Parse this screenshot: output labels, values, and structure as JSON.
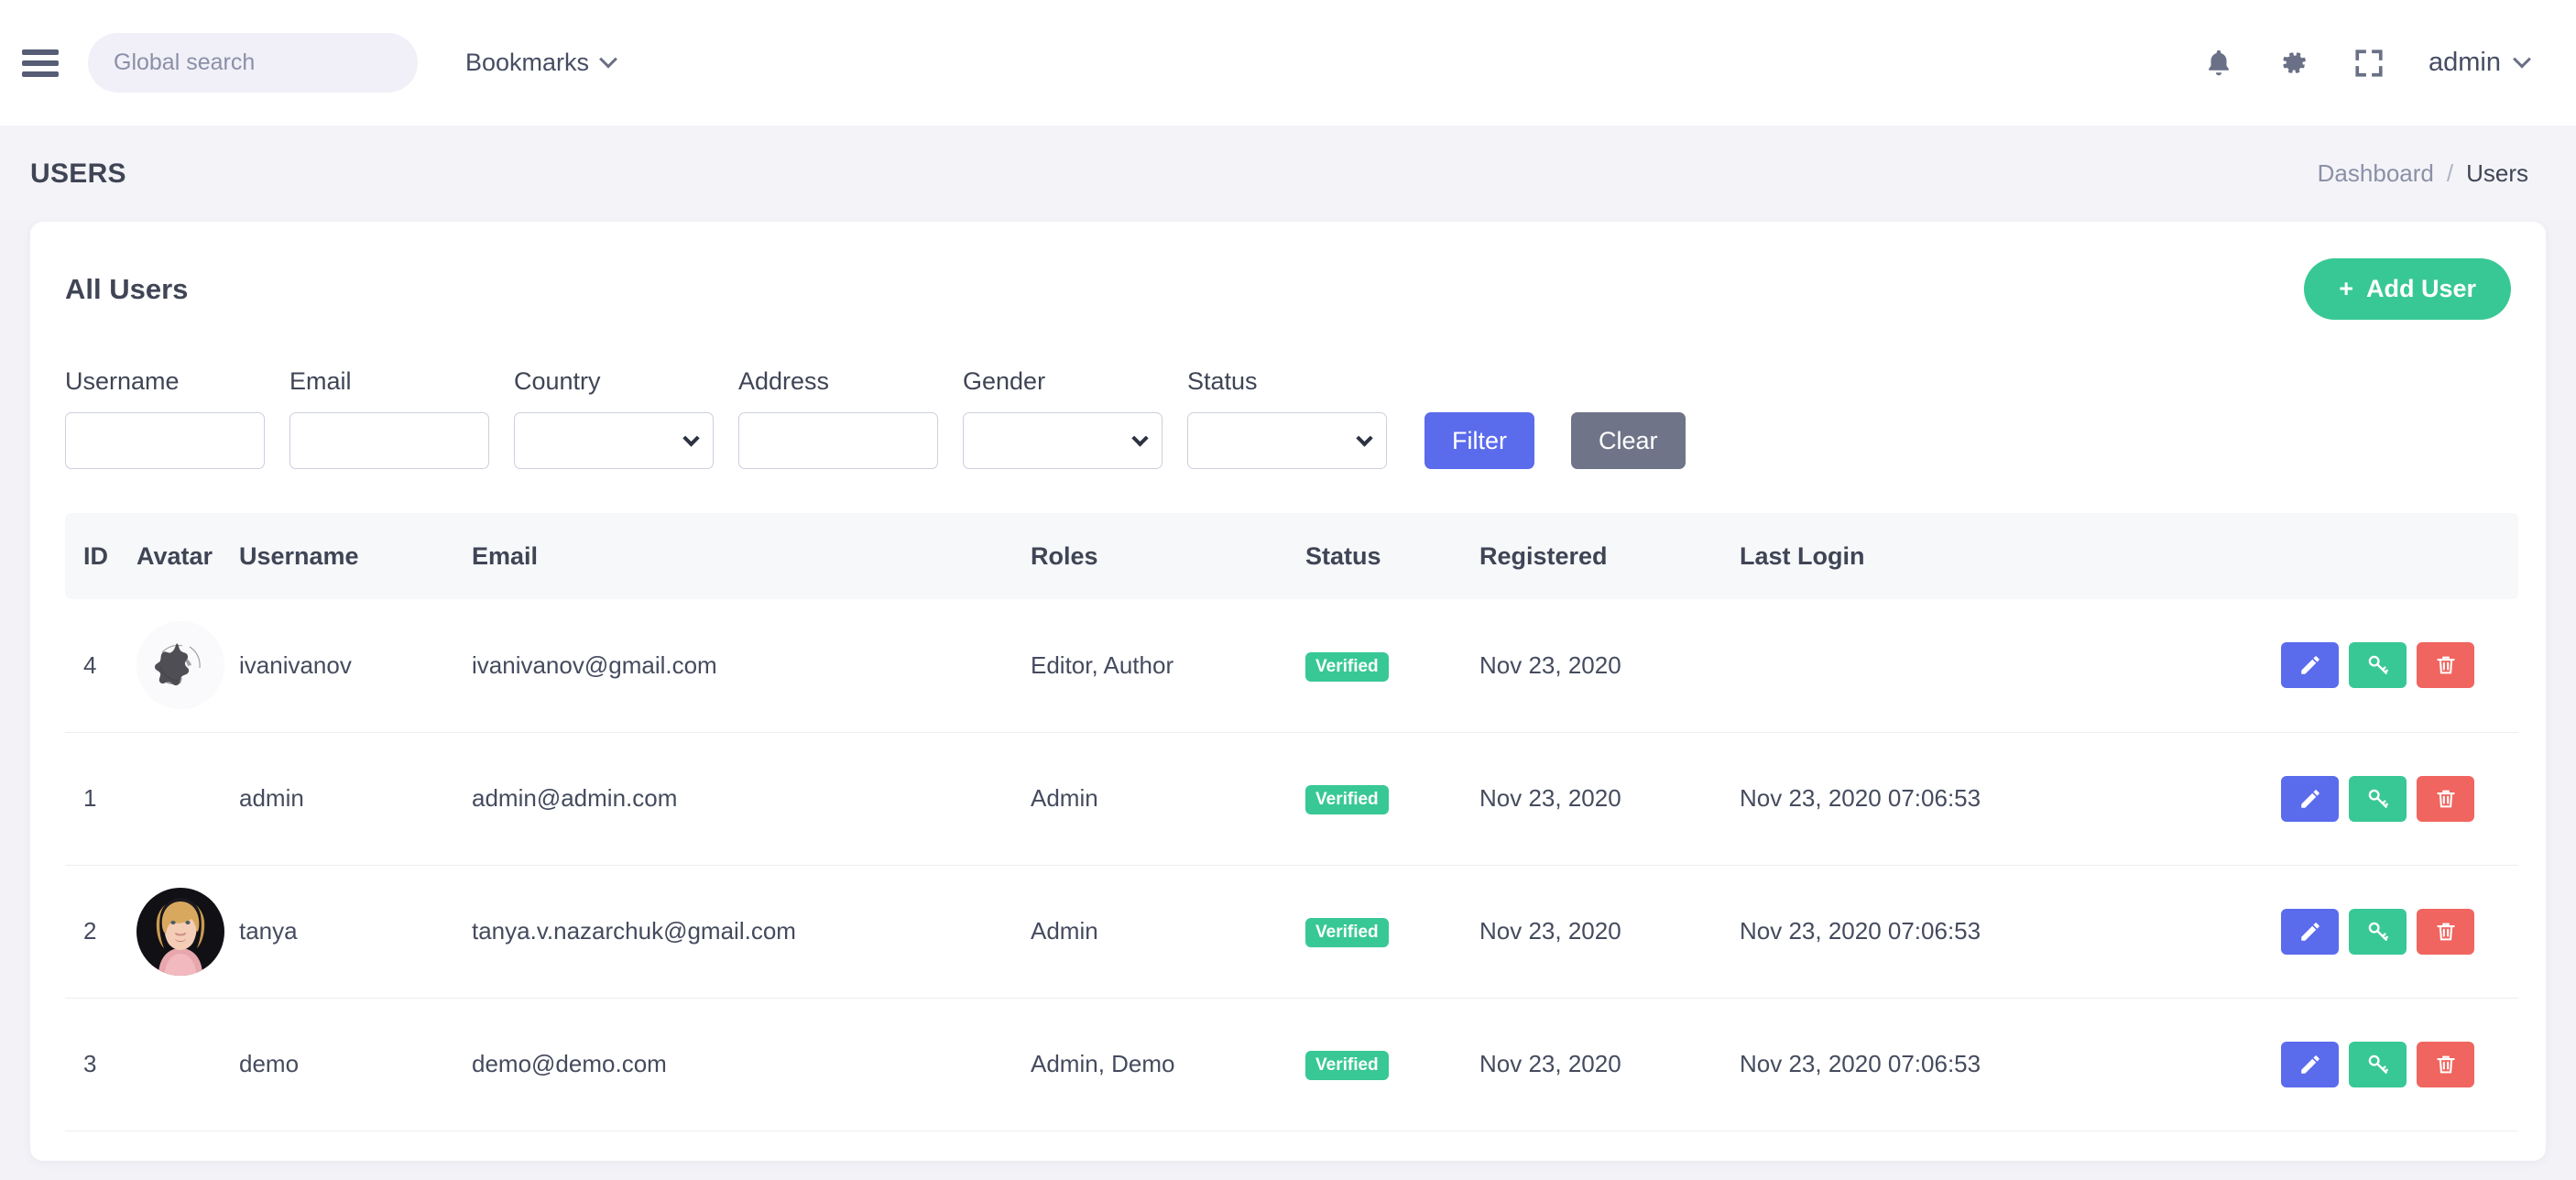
{
  "navbar": {
    "menu_icon": "hamburger-icon",
    "search": {
      "placeholder": "Global search",
      "value": ""
    },
    "bookmarks_label": "Bookmarks",
    "icons": [
      "bell-icon",
      "gear-icon",
      "fullscreen-icon"
    ],
    "user_label": "admin"
  },
  "page": {
    "title": "USERS",
    "breadcrumb": {
      "parent": "Dashboard",
      "separator": "/",
      "current": "Users"
    }
  },
  "card": {
    "title": "All Users",
    "add_user_label": "Add User",
    "add_user_plus": "+"
  },
  "filters": {
    "fields": [
      {
        "label": "Username",
        "type": "text",
        "value": "",
        "placeholder": ""
      },
      {
        "label": "Email",
        "type": "text",
        "value": "",
        "placeholder": ""
      },
      {
        "label": "Country",
        "type": "select",
        "value": ""
      },
      {
        "label": "Address",
        "type": "text",
        "value": "",
        "placeholder": ""
      },
      {
        "label": "Gender",
        "type": "select",
        "value": ""
      },
      {
        "label": "Status",
        "type": "select",
        "value": ""
      }
    ],
    "filter_button": "Filter",
    "clear_button": "Clear"
  },
  "table": {
    "columns": [
      "ID",
      "Avatar",
      "Username",
      "Email",
      "Roles",
      "Status",
      "Registered",
      "Last Login"
    ],
    "rows": [
      {
        "id": "4",
        "avatar": "sketch-avatar",
        "username": "ivanivanov",
        "email": "ivanivanov@gmail.com",
        "roles": "Editor, Author",
        "status": "Verified",
        "registered": "Nov 23, 2020",
        "last_login": ""
      },
      {
        "id": "1",
        "avatar": "",
        "username": "admin",
        "email": "admin@admin.com",
        "roles": "Admin",
        "status": "Verified",
        "registered": "Nov 23, 2020",
        "last_login": "Nov 23, 2020 07:06:53"
      },
      {
        "id": "2",
        "avatar": "photo-avatar",
        "username": "tanya",
        "email": "tanya.v.nazarchuk@gmail.com",
        "roles": "Admin",
        "status": "Verified",
        "registered": "Nov 23, 2020",
        "last_login": "Nov 23, 2020 07:06:53"
      },
      {
        "id": "3",
        "avatar": "",
        "username": "demo",
        "email": "demo@demo.com",
        "roles": "Admin, Demo",
        "status": "Verified",
        "registered": "Nov 23, 2020",
        "last_login": "Nov 23, 2020 07:06:53"
      }
    ],
    "row_actions": [
      "edit-icon",
      "key-icon",
      "trash-icon"
    ]
  },
  "colors": {
    "accent_green": "#38c895",
    "accent_indigo": "#5a6bec",
    "accent_red": "#f0655f",
    "accent_gray": "#6f7489",
    "page_bg": "#f4f4f8",
    "text_dark": "#3f4555"
  }
}
